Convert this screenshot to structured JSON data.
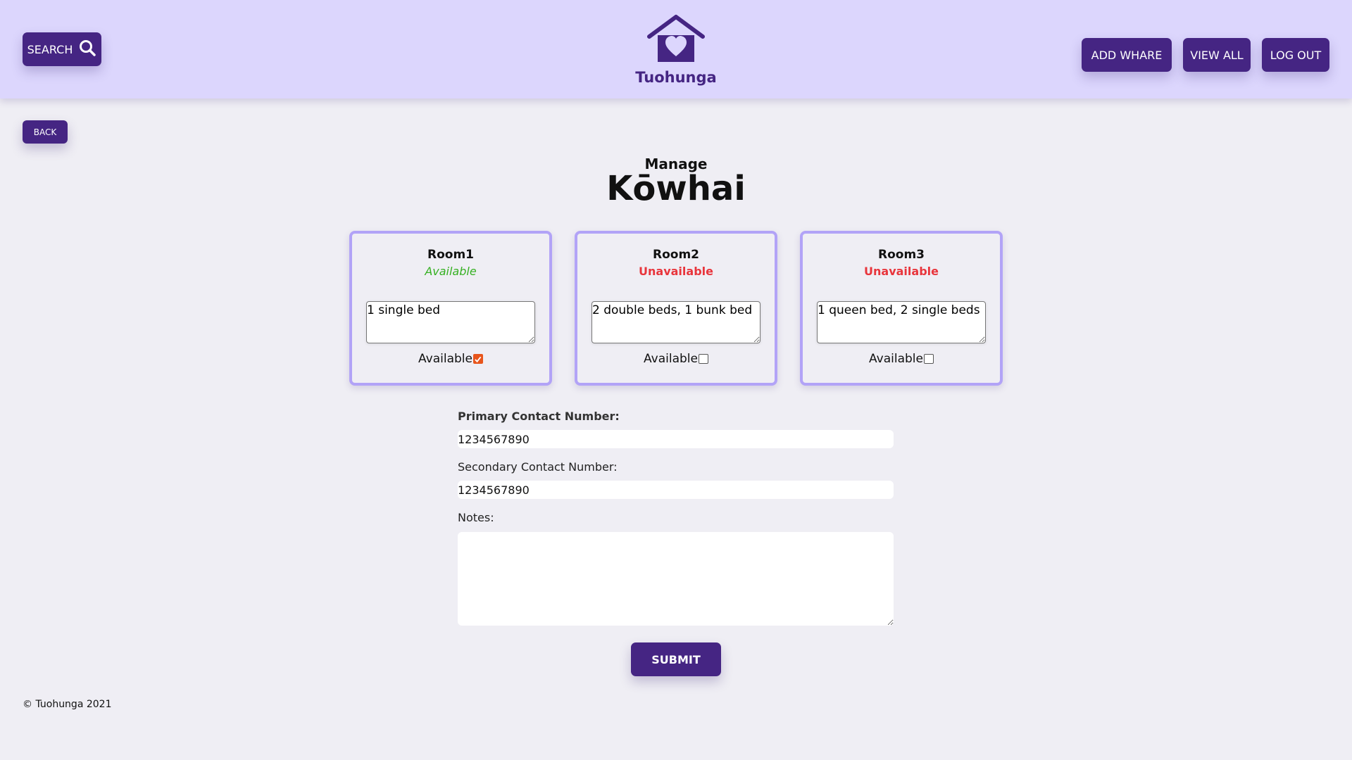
{
  "header": {
    "search_label": "SEARCH",
    "logo_text": "Tuohunga",
    "nav": {
      "add_whare": "ADD WHARE",
      "view_all": "VIEW ALL",
      "log_out": "LOG OUT"
    }
  },
  "back_label": "BACK",
  "title": {
    "small": "Manage",
    "big": "Kōwhai"
  },
  "rooms": [
    {
      "name": "Room1",
      "status": "Available",
      "description": "1 single bed",
      "available_label": "Available",
      "available": true
    },
    {
      "name": "Room2",
      "status": "Unavailable",
      "description": "2 double beds, 1 bunk bed",
      "available_label": "Available",
      "available": false
    },
    {
      "name": "Room3",
      "status": "Unavailable",
      "description": "1 queen bed, 2 single beds",
      "available_label": "Available",
      "available": false
    }
  ],
  "form": {
    "primary_label": "Primary Contact Number:",
    "primary_value": "1234567890",
    "secondary_label": "Secondary Contact Number:",
    "secondary_value": "1234567890",
    "notes_label": "Notes:",
    "notes_value": "",
    "submit_label": "SUBMIT"
  },
  "footer": "© Tuohunga 2021",
  "colors": {
    "primary": "#452583",
    "header_bg": "#dcd6fd",
    "card_border": "#b2a3f7",
    "available": "#35b021",
    "unavailable": "#e8353c",
    "checkbox_checked": "#e8551c"
  }
}
